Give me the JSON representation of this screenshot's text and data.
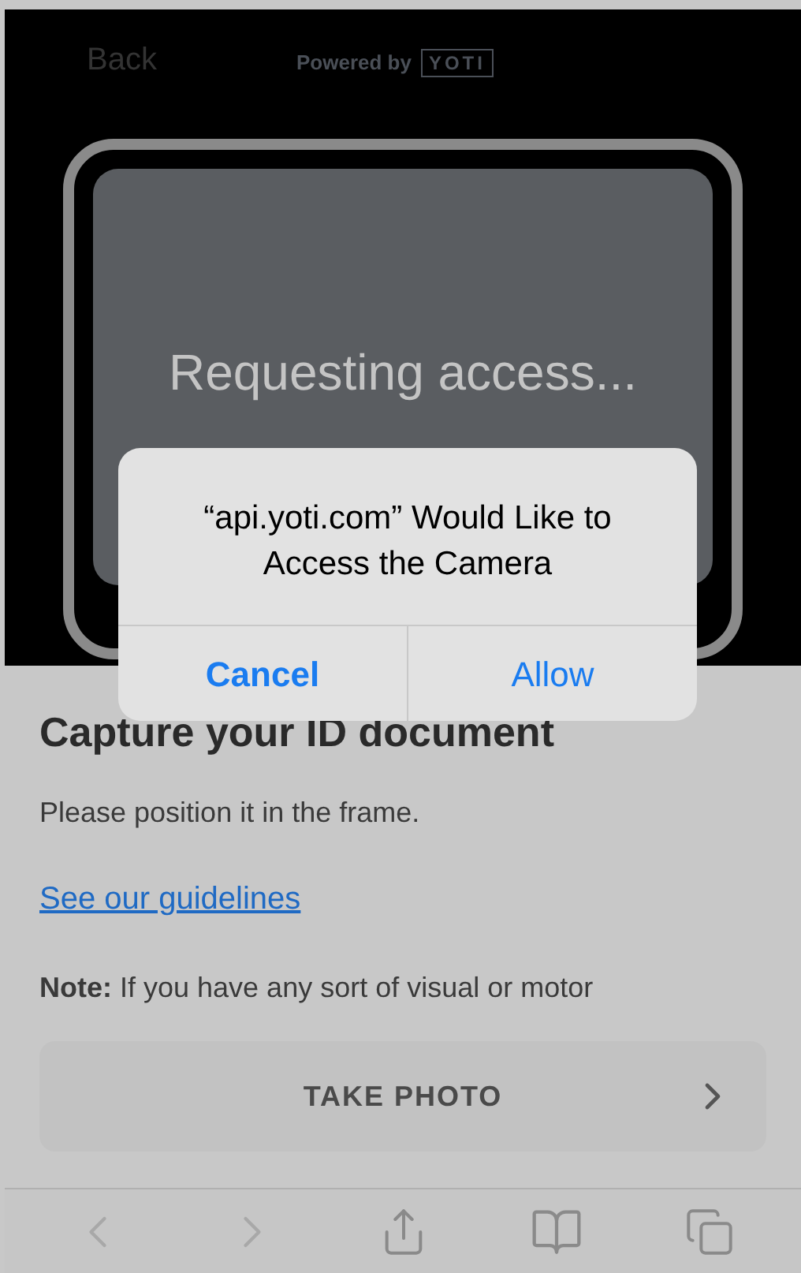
{
  "header": {
    "back": "Back",
    "powered_by": "Powered by",
    "logo": "YOTI"
  },
  "camera": {
    "status": "Requesting access..."
  },
  "dialog": {
    "title": "“api.yoti.com” Would Like to Access the Camera",
    "buttons": [
      {
        "label": "Cancel",
        "kind": "cancel"
      },
      {
        "label": "Allow",
        "kind": "default"
      }
    ]
  },
  "content": {
    "heading": "Capture your ID document",
    "instruction": "Please position it in the frame.",
    "link": "See our guidelines",
    "note": "**Note:** If you have any sort of visual or motor",
    "button": "TAKE PHOTO"
  }
}
